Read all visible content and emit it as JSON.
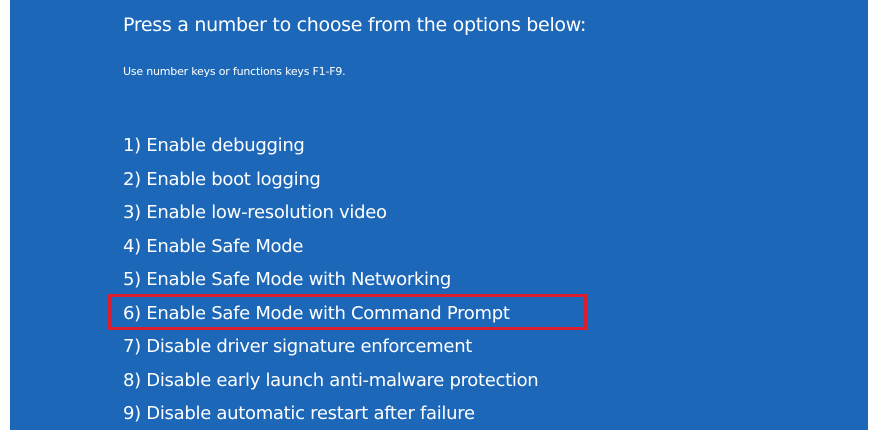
{
  "screen": {
    "heading": "Press a number to choose from the options below:",
    "subheading": "Use number keys or functions keys F1-F9.",
    "options": [
      {
        "label": "1) Enable debugging"
      },
      {
        "label": "2) Enable boot logging"
      },
      {
        "label": "3) Enable low-resolution video"
      },
      {
        "label": "4) Enable Safe Mode"
      },
      {
        "label": "5) Enable Safe Mode with Networking"
      },
      {
        "label": "6) Enable Safe Mode with Command Prompt",
        "highlighted": true
      },
      {
        "label": "7) Disable driver signature enforcement"
      },
      {
        "label": "8) Disable early launch anti-malware protection"
      },
      {
        "label": "9) Disable automatic restart after failure"
      }
    ]
  },
  "colors": {
    "background": "#1c67b8",
    "text": "#ffffff",
    "highlight_border": "#d91f2f"
  }
}
